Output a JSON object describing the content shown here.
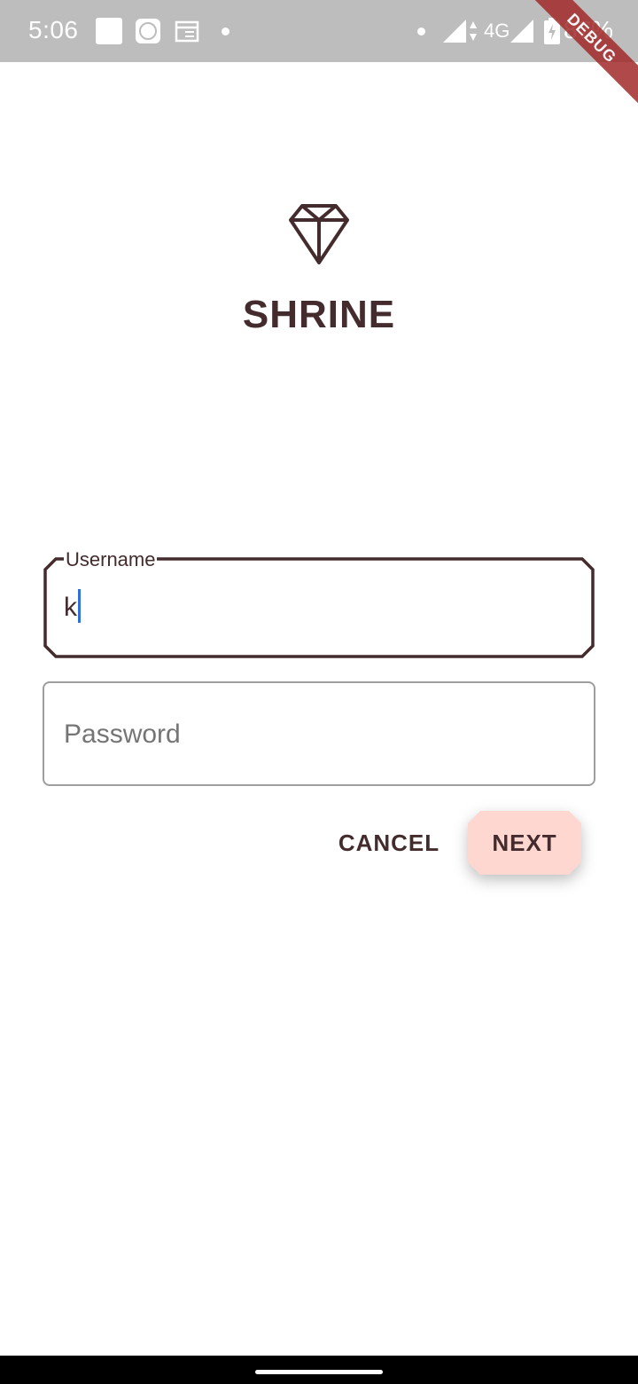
{
  "status_bar": {
    "time": "5:06",
    "network": "4G",
    "battery": "87%"
  },
  "debug_banner": "DEBUG",
  "app": {
    "title": "SHRINE"
  },
  "form": {
    "username": {
      "label": "Username",
      "value": "k"
    },
    "password": {
      "placeholder": "Password",
      "value": ""
    },
    "cancel_label": "CANCEL",
    "next_label": "NEXT"
  },
  "colors": {
    "brand_brown": "#442b2d",
    "next_button_bg": "#fed8d0",
    "caret_blue": "#2f6fd8",
    "status_bar_bg": "#bdbdbd"
  },
  "icons": {
    "logo": "diamond-icon"
  }
}
